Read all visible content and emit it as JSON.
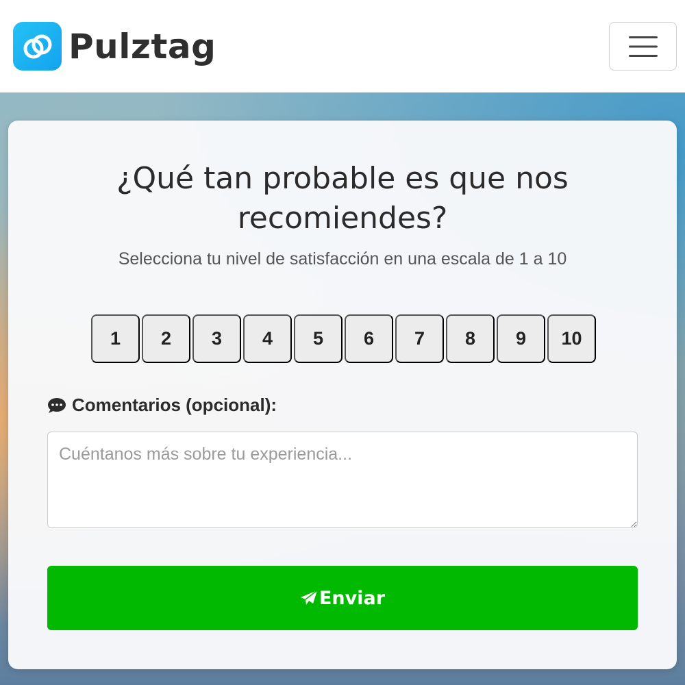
{
  "header": {
    "brand_name": "Pulztag",
    "logo_icon": "link-circles-icon",
    "menu_icon": "hamburger-icon"
  },
  "survey": {
    "title": "¿Qué tan probable es que nos recomiendes?",
    "subtitle": "Selecciona tu nivel de satisfacción en una escala de 1 a 10",
    "scale": [
      "1",
      "2",
      "3",
      "4",
      "5",
      "6",
      "7",
      "8",
      "9",
      "10"
    ],
    "comments_label": "Comentarios (opcional):",
    "comments_icon": "comment-icon",
    "comments_value": "",
    "comments_placeholder": "Cuéntanos más sobre tu experiencia...",
    "submit_label": "Enviar",
    "submit_icon": "paper-plane-icon"
  },
  "colors": {
    "brand_blue": "#1ab0f0",
    "submit_green": "#00b900",
    "scale_button_bg": "#ececec"
  }
}
